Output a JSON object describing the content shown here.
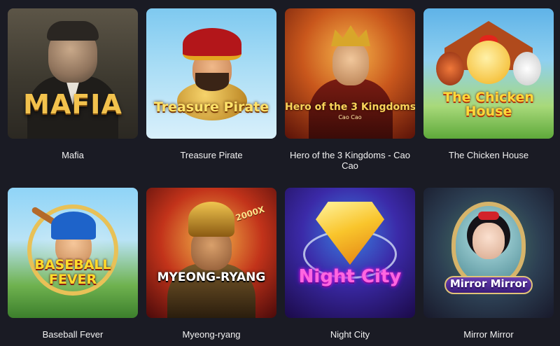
{
  "games": [
    {
      "title": "Mafia",
      "logo": "MAFIA"
    },
    {
      "title": "Treasure Pirate",
      "logo": "Treasure Pirate"
    },
    {
      "title": "Hero of the 3 Kingdoms - Cao Cao",
      "logo": "Hero of the 3 Kingdoms",
      "logo_sub": "Cao Cao"
    },
    {
      "title": "The Chicken House",
      "logo": "The Chicken\nHouse"
    },
    {
      "title": "Baseball Fever",
      "logo": "BASEBALL\nFEVER"
    },
    {
      "title": "Myeong-ryang",
      "logo": "MYEONG-RYANG",
      "badge": "2000X"
    },
    {
      "title": "Night City",
      "logo": "Night City"
    },
    {
      "title": "Mirror Mirror",
      "logo": "Mirror Mirror"
    }
  ],
  "colors": {
    "background": "#1a1b24",
    "label_text": "#f2f2f2"
  }
}
